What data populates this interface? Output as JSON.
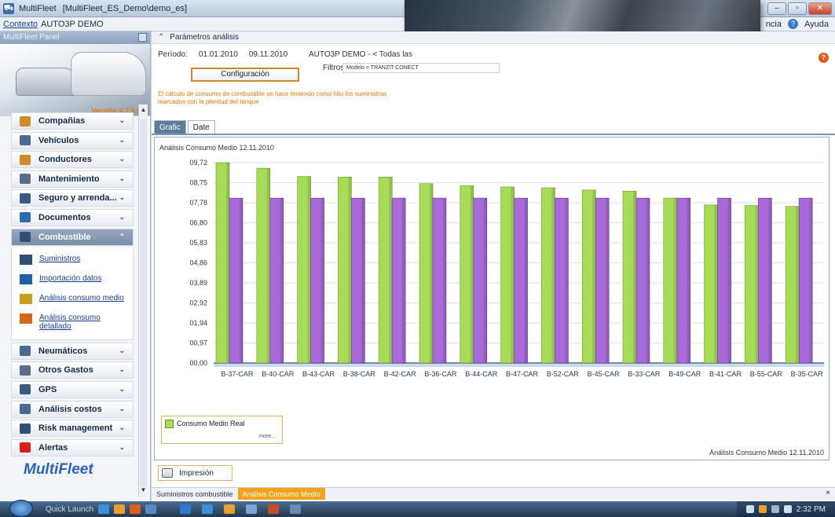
{
  "window": {
    "app_name": "MultiFleet",
    "title": "[MultiFleet_ES_Demo\\demo_es]",
    "controls": [
      "–",
      "▫",
      "✕"
    ]
  },
  "context": {
    "link": "Contexto",
    "value": "AUTO3P DEMO",
    "help_left": "ncia",
    "help": "Ayuda"
  },
  "panel": {
    "title": "MultiFleet Panel",
    "version": "Versión 4.7.5.0",
    "logo": "MultiFleet",
    "nav": [
      {
        "label": "Compañías",
        "icon": "companies-icon",
        "color": "#d08a2a"
      },
      {
        "label": "Vehículos",
        "icon": "car-icon",
        "color": "#4a6a94"
      },
      {
        "label": "Conductores",
        "icon": "drivers-icon",
        "color": "#d08a2a"
      },
      {
        "label": "Mantenimiento",
        "icon": "wrench-icon",
        "color": "#5a6f86"
      },
      {
        "label": "Seguro y arrenda...",
        "icon": "insurance-icon",
        "color": "#3c5a80"
      },
      {
        "label": "Documentos",
        "icon": "documents-icon",
        "color": "#2f6aa8"
      },
      {
        "label": "Combustible",
        "icon": "fuel-icon",
        "color": "#2f4f76"
      },
      {
        "label": "Neumáticos",
        "icon": "tires-icon",
        "color": "#4a6a94"
      },
      {
        "label": "Otros Gastos",
        "icon": "expenses-icon",
        "color": "#5a6f86"
      },
      {
        "label": "GPS",
        "icon": "gps-icon",
        "color": "#3c5a80"
      },
      {
        "label": "Análisis costos",
        "icon": "cost-analysis-icon",
        "color": "#4a6a94"
      },
      {
        "label": "Risk management",
        "icon": "risk-icon",
        "color": "#2f4f76"
      },
      {
        "label": "Alertas",
        "icon": "alert-icon",
        "color": "#d62020"
      }
    ],
    "sub_items": [
      {
        "label": "Suministros",
        "icon": "fuel-nozzle-icon"
      },
      {
        "label": "Importación datos",
        "icon": "import-icon"
      },
      {
        "label": "Análisis consumo medio",
        "icon": "bar-chart-icon"
      },
      {
        "label": "Análisis consumo detallado",
        "icon": "detail-chart-icon"
      }
    ]
  },
  "params": {
    "header": "Parámetros análisis",
    "period_label": "Período:",
    "date_from": "01.01.2010",
    "date_to": "09.11.2010",
    "company": "AUTO3P DEMO - < Todas las",
    "filters_label": "Filtros",
    "filters_value": "Modelo = TRANZIT CONECT",
    "config_button": "Configuración",
    "note": "El cálculo de consumo de combustible se hace teniendo como hito los suministros marcados con la plenitud del tanque"
  },
  "tabs": [
    "Grafic",
    "Date"
  ],
  "chart_data": {
    "type": "bar",
    "title": "Análisis Consumo Medio 12.11.2010",
    "categories": [
      "B-37-CAR",
      "B-40-CAR",
      "B-43-CAR",
      "B-38-CAR",
      "B-42-CAR",
      "B-36-CAR",
      "B-44-CAR",
      "B-47-CAR",
      "B-52-CAR",
      "B-45-CAR",
      "B-33-CAR",
      "B-49-CAR",
      "B-41-CAR",
      "B-55-CAR",
      "B-35-CAR"
    ],
    "series": [
      {
        "name": "Consumo Medio Real",
        "color": "#a8dc58",
        "values": [
          9.72,
          9.45,
          9.05,
          9.02,
          9.02,
          8.7,
          8.6,
          8.54,
          8.5,
          8.39,
          8.34,
          8.0,
          7.67,
          7.64,
          7.6
        ]
      },
      {
        "color": "#a86ad8",
        "values": [
          8.0,
          8.0,
          8.0,
          8.0,
          8.0,
          8.0,
          8.0,
          8.0,
          8.0,
          8.0,
          8.0,
          8.0,
          8.0,
          8.0,
          8.0
        ]
      }
    ],
    "y_ticks": [
      "09,72",
      "08,75",
      "07,78",
      "06,80",
      "05,83",
      "04,86",
      "03,89",
      "02,92",
      "01,94",
      "00,97",
      "00,00"
    ],
    "ylim": [
      0,
      9.72
    ],
    "legend": "bottom-left",
    "legend_more": "more...",
    "footer": "Análisis Consumo Medio 12.11.2010"
  },
  "print_button": "Impresión",
  "bottom_tabs": [
    "Suministros combustible",
    "Análisis Consumo Medio"
  ],
  "taskbar": {
    "quick_launch": "Quick Launch",
    "time": "2:32 PM"
  }
}
